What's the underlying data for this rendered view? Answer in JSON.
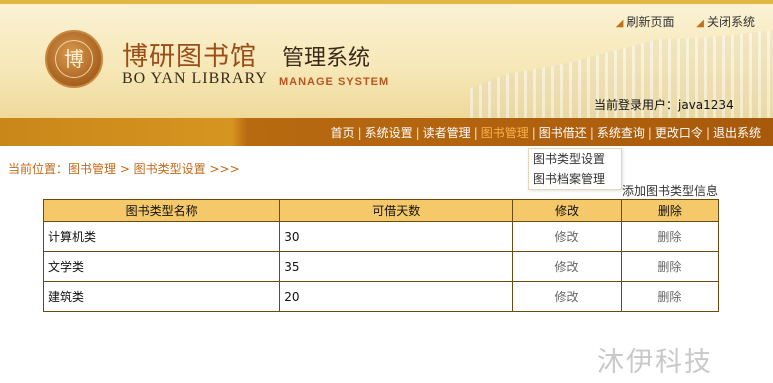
{
  "header": {
    "logo_seal_char": "博",
    "title_cn": "博研图书馆",
    "title_cn_suffix": "管理系统",
    "title_en": "BO YAN LIBRARY",
    "title_en_suffix": "MANAGE SYSTEM",
    "top_links": [
      "刷新页面",
      "关闭系统"
    ],
    "current_user_label": "当前登录用户：",
    "current_user": "java1234"
  },
  "nav": {
    "items": [
      "首页",
      "系统设置",
      "读者管理",
      "图书管理",
      "图书借还",
      "系统查询",
      "更改口令",
      "退出系统"
    ],
    "active": "图书管理",
    "separator": "|"
  },
  "dropdown": {
    "items": [
      "图书类型设置",
      "图书档案管理"
    ]
  },
  "breadcrumb": "当前位置：图书管理 > 图书类型设置 >>>",
  "add_link": "添加图书类型信息",
  "table": {
    "headers": [
      "图书类型名称",
      "可借天数",
      "修改",
      "删除"
    ],
    "rows": [
      {
        "name": "计算机类",
        "days": "30",
        "edit": "修改",
        "delete": "删除"
      },
      {
        "name": "文学类",
        "days": "35",
        "edit": "修改",
        "delete": "删除"
      },
      {
        "name": "建筑类",
        "days": "20",
        "edit": "修改",
        "delete": "删除"
      }
    ]
  },
  "watermark": "沐伊科技",
  "colors": {
    "header_bg": "#f6e7b6",
    "nav_bg": "#a85a0c",
    "nav_active": "#ffb04a",
    "table_header": "#f5c96a",
    "breadcrumb": "#c2691a"
  }
}
